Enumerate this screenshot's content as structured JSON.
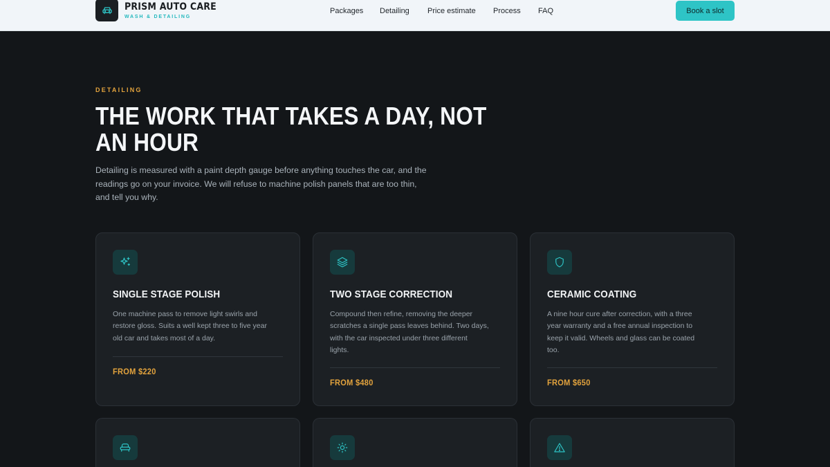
{
  "header": {
    "brand_name": "PRISM AUTO CARE",
    "brand_tagline": "WASH & DETAILING",
    "nav": [
      "Packages",
      "Detailing",
      "Price estimate",
      "Process",
      "FAQ"
    ],
    "cta": "Book a slot"
  },
  "hero": {
    "eyebrow": "DETAILING",
    "title_lines": [
      "THE WORK THAT TAKES A DAY, NOT",
      "AN HOUR"
    ],
    "text_lines": [
      "Detailing is measured with a paint depth gauge before anything touches the car, and the",
      "readings go on your invoice. We will refuse to machine polish panels that are too thin,",
      "and tell you why."
    ]
  },
  "cards": [
    {
      "icon": "sparkles-icon",
      "title": "SINGLE STAGE POLISH",
      "desc_lines": [
        "One machine pass to remove light swirls and",
        "restore gloss. Suits a well kept three to five year",
        "old car and takes most of a day."
      ],
      "price": "FROM $220"
    },
    {
      "icon": "layers-icon",
      "title": "TWO STAGE CORRECTION",
      "desc_lines": [
        "Compound then refine, removing the deeper",
        "scratches a single pass leaves behind. Two days,",
        "with the car inspected under three different",
        "lights."
      ],
      "price": "FROM $480"
    },
    {
      "icon": "shield-icon",
      "title": "CERAMIC COATING",
      "desc_lines": [
        "A nine hour cure after correction, with a three",
        "year warranty and a free annual inspection to",
        "keep it valid. Wheels and glass can be coated",
        "too."
      ],
      "price": "FROM $650"
    },
    {
      "icon": "seat-icon"
    },
    {
      "icon": "sun-icon"
    },
    {
      "icon": "warning-icon"
    }
  ],
  "colors": {
    "accent": "#2ec4c6",
    "price": "#e3a33d",
    "background": "#131619",
    "card": "#1c2024"
  }
}
